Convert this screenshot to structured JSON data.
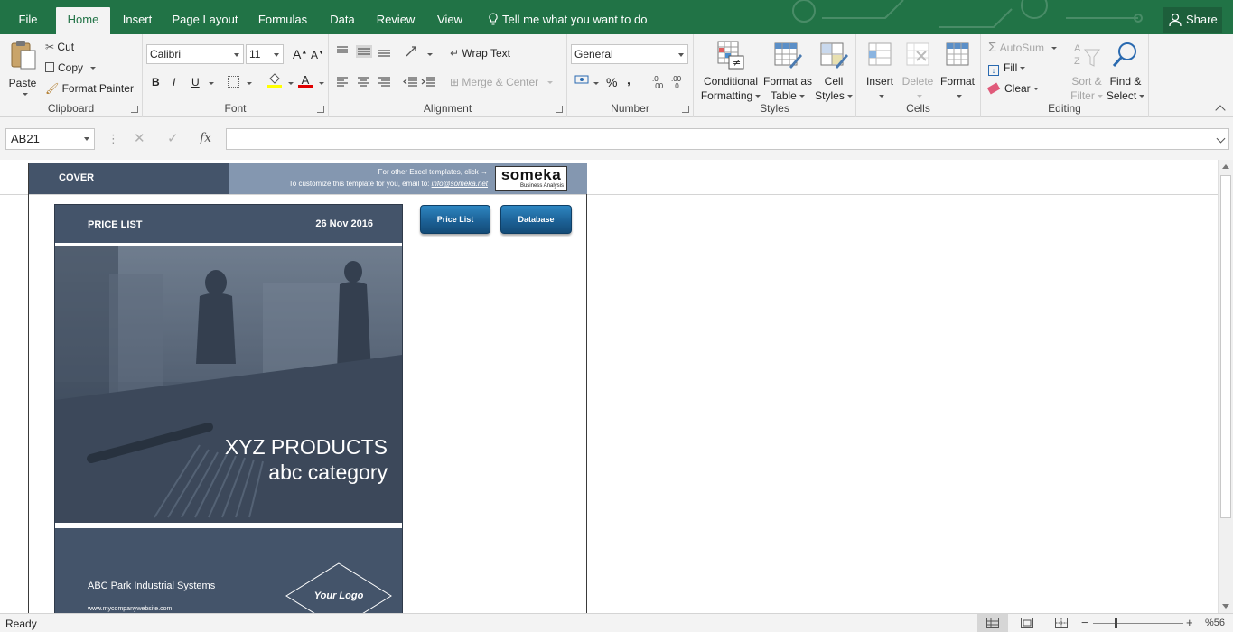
{
  "tabs": [
    {
      "label": "File",
      "active": false
    },
    {
      "label": "Home",
      "active": true
    },
    {
      "label": "Insert",
      "active": false
    },
    {
      "label": "Page Layout",
      "active": false
    },
    {
      "label": "Formulas",
      "active": false
    },
    {
      "label": "Data",
      "active": false
    },
    {
      "label": "Review",
      "active": false
    },
    {
      "label": "View",
      "active": false
    }
  ],
  "tell_me": "Tell me what you want to do",
  "share": "Share",
  "clipboard": {
    "paste": "Paste",
    "cut": "Cut",
    "copy": "Copy",
    "format_painter": "Format Painter",
    "label": "Clipboard"
  },
  "font": {
    "name": "Calibri",
    "size": "11",
    "label": "Font",
    "bold": "B",
    "italic": "I",
    "underline": "U",
    "grow": "A",
    "shrink": "A",
    "color": "A"
  },
  "alignment": {
    "wrap_text": "Wrap Text",
    "merge_center": "Merge & Center",
    "label": "Alignment"
  },
  "number": {
    "format": "General",
    "percent": "%",
    "comma": "‚",
    "inc_decimal": "←.0\n.00",
    "label": "Number"
  },
  "styles": {
    "conditional": "Conditional",
    "conditional2": "Formatting",
    "format_table": "Format as",
    "format_table2": "Table",
    "cell_styles": "Cell",
    "cell_styles2": "Styles",
    "label": "Styles"
  },
  "cells": {
    "insert": "Insert",
    "delete": "Delete",
    "format": "Format",
    "label": "Cells"
  },
  "editing": {
    "autosum": "AutoSum",
    "fill": "Fill",
    "clear": "Clear",
    "sort": "Sort &",
    "sort2": "Filter",
    "find": "Find &",
    "find2": "Select",
    "label": "Editing"
  },
  "formula_bar": {
    "name_box": "AB21",
    "fx": "fx",
    "formula": ""
  },
  "sheet": {
    "cover_label": "COVER",
    "templates_line": "For other Excel templates, click →",
    "customize_line": "To customize this template for you, email to:",
    "email": "info@someka.net",
    "brand": "someka",
    "brand_sub": "Business Analysis",
    "card_title": "PRICE LIST",
    "card_date": "26 Nov 2016",
    "product": "XYZ PRODUCTS",
    "category": "abc category",
    "company": "ABC Park Industrial Systems",
    "website": "www.mycompanywebsite.com",
    "logo": "Your Logo",
    "btn_price_list": "Price List",
    "btn_database": "Database"
  },
  "status": {
    "ready": "Ready",
    "zoom": "%56"
  },
  "colors": {
    "excel_green": "#217346",
    "cover_dark": "#44546a",
    "cover_light": "#8497b0",
    "button_blue": "#1b5f93"
  }
}
